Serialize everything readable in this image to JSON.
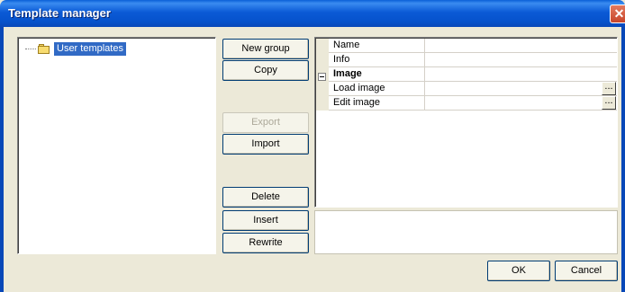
{
  "window": {
    "title": "Template manager"
  },
  "tree": {
    "items": [
      {
        "label": "User templates",
        "selected": true
      }
    ]
  },
  "actions": {
    "new_group": "New group",
    "copy": "Copy",
    "export": "Export",
    "import": "Import",
    "delete": "Delete",
    "insert": "Insert",
    "rewrite": "Rewrite"
  },
  "properties": {
    "rows": [
      {
        "name": "Name",
        "value": ""
      },
      {
        "name": "Info",
        "value": ""
      },
      {
        "name": "Image",
        "value": "",
        "category": true,
        "expanded": true
      },
      {
        "name": "Load image",
        "value": "",
        "has_button": true
      },
      {
        "name": "Edit image",
        "value": "",
        "has_button": true
      }
    ],
    "ellipsis": "..."
  },
  "dialog": {
    "ok": "OK",
    "cancel": "Cancel"
  },
  "colors": {
    "titlebar": "#0b5ad6",
    "selection": "#316ac5",
    "face": "#ece9d8"
  }
}
